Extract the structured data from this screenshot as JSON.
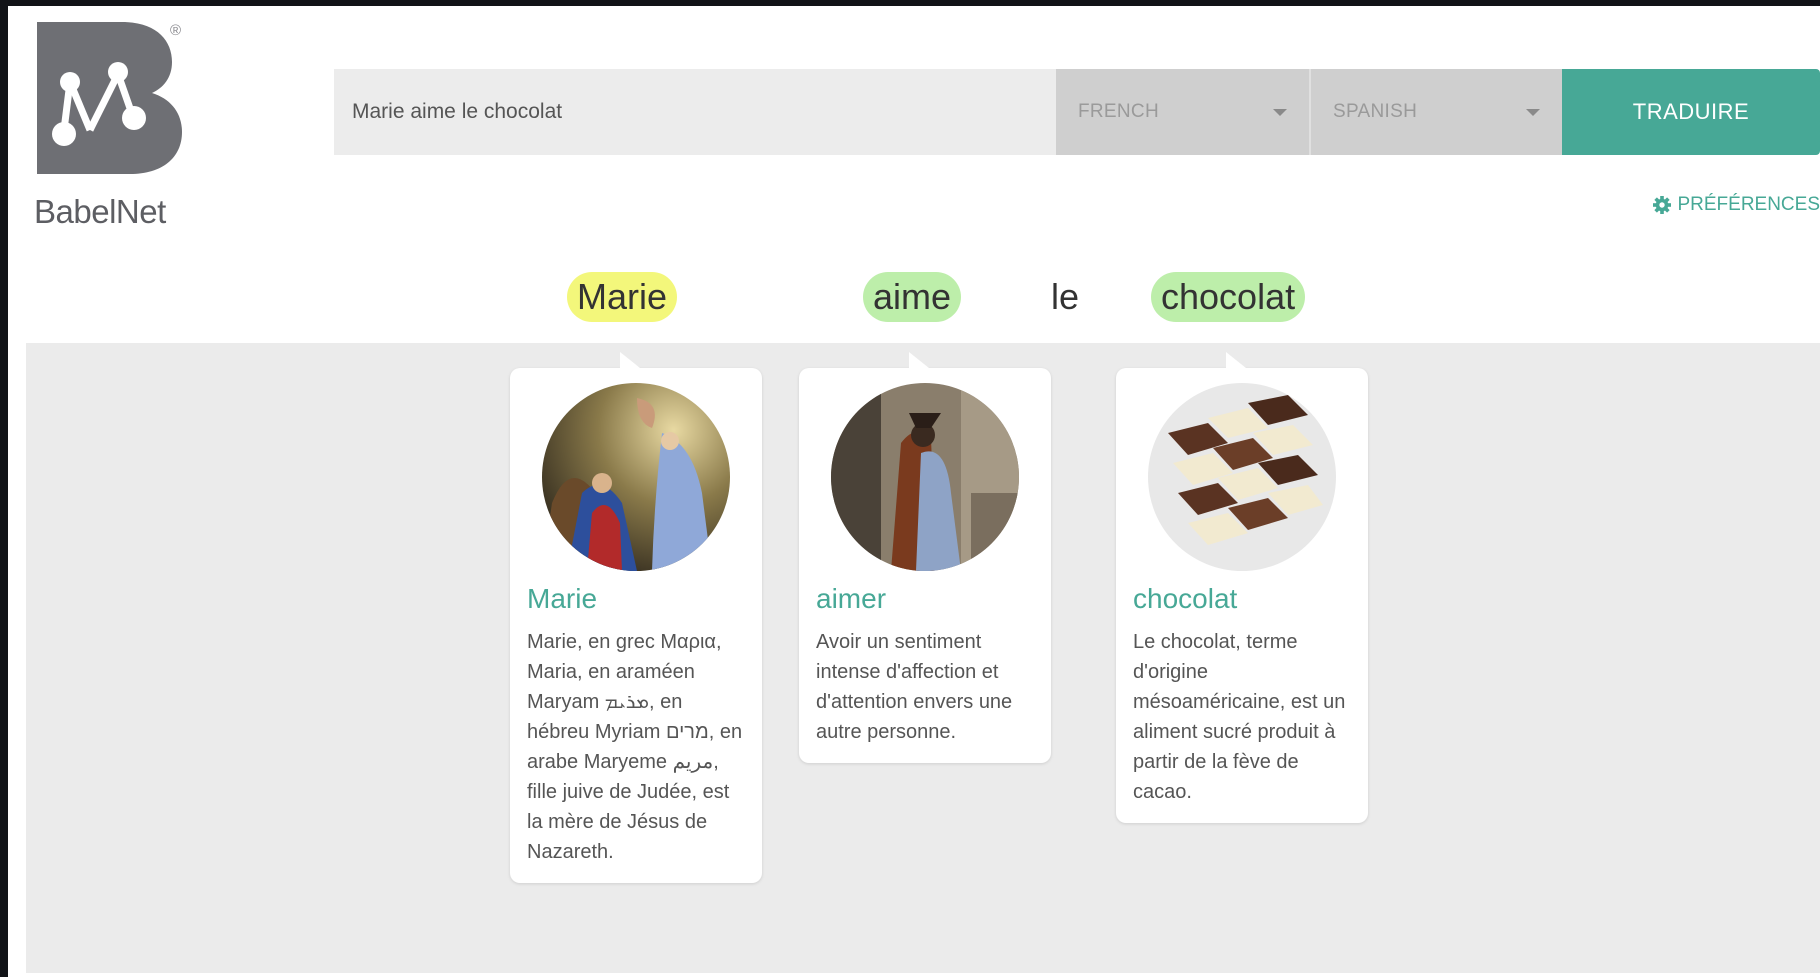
{
  "app": {
    "brand": "BabelNet",
    "registered": "®"
  },
  "search": {
    "value": "Marie aime le chocolat",
    "source_lang": "FRENCH",
    "target_lang": "SPANISH",
    "translate_label": "TRADUIRE"
  },
  "preferences_label": "PRÉFÉRENCES",
  "sentence": [
    {
      "text": "Marie",
      "highlight": "yellow"
    },
    {
      "text": "aime",
      "highlight": "green"
    },
    {
      "text": "le",
      "highlight": "none"
    },
    {
      "text": "chocolat",
      "highlight": "green"
    }
  ],
  "cards": [
    {
      "title": "Marie",
      "image": "annunciation-painting",
      "description": "Marie, en grec Μαρια, Maria, en araméen Maryam ܡܪܝܡ, en hébreu Myriam מרים, en arabe Maryeme مريم, fille juive de Judée, est la mère de Jésus de Nazareth."
    },
    {
      "title": "aimer",
      "image": "the-kiss-painting",
      "description": "Avoir un sentiment intense d'affection et d'attention envers une autre personne."
    },
    {
      "title": "chocolat",
      "image": "chocolate-bars-photo",
      "description": "Le chocolat, terme d'origine mésoaméricaine, est un aliment sucré produit à partir de la fève de cacao."
    }
  ],
  "colors": {
    "accent": "#47a896",
    "highlight_yellow": "#f3f77b",
    "highlight_green": "#bdeeaa",
    "panel": "#ebebeb",
    "logo": "#6e6f74"
  }
}
